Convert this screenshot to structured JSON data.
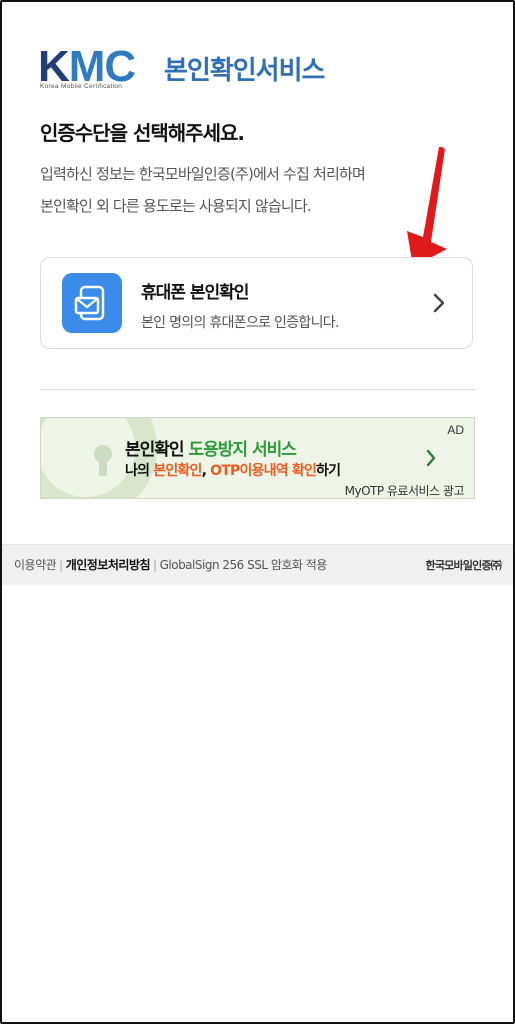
{
  "header": {
    "logo_text_k": "K",
    "logo_text_mc": "MC",
    "logo_subtitle": "Korea Mobile Certification",
    "service_title": "본인확인서비스"
  },
  "main": {
    "heading": "인증수단을 선택해주세요.",
    "description_line1": "입력하신 정보는 한국모바일인증(주)에서 수집 처리하며",
    "description_line2": "본인확인 외 다른 용도로는 사용되지 않습니다.",
    "option": {
      "title": "휴대폰 본인확인",
      "subtitle": "본인 명의의 휴대폰으로 인증합니다.",
      "icon": "phone-mail-icon"
    }
  },
  "ad": {
    "label": "AD",
    "line1_part1": "본인확인 ",
    "line1_part2": "도용방지 서비스",
    "line2_part1": "나의 ",
    "line2_part2": "본인확인",
    "line2_part3": ", ",
    "line2_part4": "OTP이용내역",
    "line2_part5": " ",
    "line2_part6": "확인",
    "line2_part7": "하기",
    "note": "MyOTP 유료서비스 광고"
  },
  "footer": {
    "terms": "이용약관",
    "privacy": "개인정보처리방침",
    "ssl": "GlobalSign 256 SSL 암호화 적용",
    "brand": "한국모바일인증㈜"
  },
  "colors": {
    "brand_blue": "#2f6fb5",
    "icon_blue": "#3a8bea",
    "arrow_red": "#e0191b",
    "ad_green": "#2e9a3a",
    "ad_orange": "#ef5a1f"
  }
}
